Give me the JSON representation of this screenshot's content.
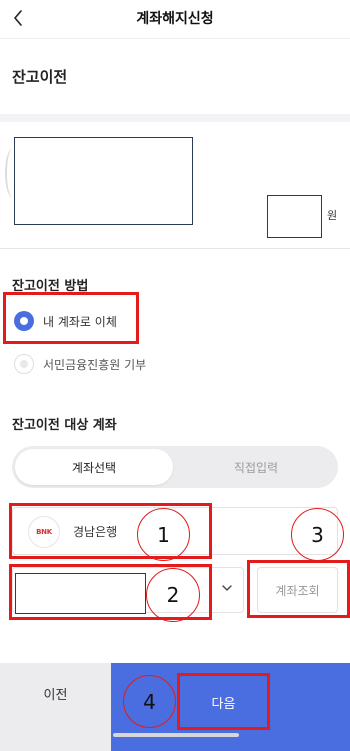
{
  "header": {
    "title": "계좌해지신청"
  },
  "section": {
    "title": "잔고이전"
  },
  "amount": {
    "unit": "원"
  },
  "method": {
    "title": "잔고이전 방법",
    "options": [
      {
        "label": "내 계좌로 이체",
        "selected": true
      },
      {
        "label": "서민금융진흥원 기부",
        "selected": false
      }
    ]
  },
  "target": {
    "title": "잔고이전 대상 계좌",
    "tabs": [
      {
        "label": "계좌선택",
        "active": true
      },
      {
        "label": "직접입력",
        "active": false
      }
    ],
    "bank": {
      "logo_text": "BNK",
      "name": "경남은행"
    },
    "inquiry_label": "계좌조회"
  },
  "annotations": {
    "n1": "1",
    "n2": "2",
    "n3": "3",
    "n4": "4"
  },
  "bottom": {
    "prev_label": "이전",
    "next_label": "다음"
  },
  "colors": {
    "accent": "#4a6de0",
    "annotation": "#e31b1b",
    "bank_logo": "#d6322e"
  }
}
